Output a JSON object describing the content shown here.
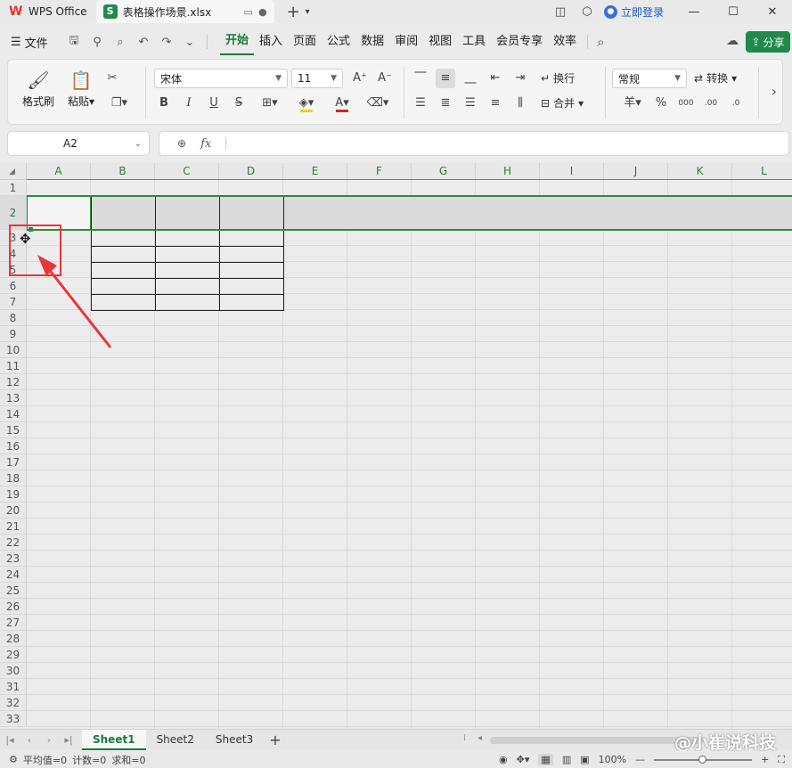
{
  "titlebar": {
    "app_tab": "WPS Office",
    "file_tab": "表格操作场景.xlsx",
    "file_badge": "S",
    "login": "立即登录"
  },
  "menubar": {
    "file": "文件",
    "items": [
      "开始",
      "插入",
      "页面",
      "公式",
      "数据",
      "审阅",
      "视图",
      "工具",
      "会员专享",
      "效率"
    ],
    "active": "开始",
    "share": "分享"
  },
  "ribbon": {
    "format_painter": "格式刷",
    "paste": "粘贴",
    "font_name": "宋体",
    "font_size": "11",
    "wrap": "换行",
    "merge": "合并",
    "number_format": "常规",
    "convert": "转换",
    "bold": "B",
    "italic": "I",
    "underline": "U",
    "strike": "S",
    "font_color_glyph": "A",
    "grow_glyph": "A",
    "shrink_glyph": "A",
    "currency": "羊",
    "percent": "%"
  },
  "formula_bar": {
    "name_box": "A2",
    "fx": "fx",
    "value": ""
  },
  "grid": {
    "columns": [
      "A",
      "B",
      "C",
      "D",
      "E",
      "F",
      "G",
      "H",
      "I",
      "J",
      "K",
      "L"
    ],
    "rows": [
      "1",
      "2",
      "3",
      "4",
      "5",
      "6",
      "7",
      "8",
      "9",
      "10",
      "11",
      "12",
      "13",
      "14",
      "15",
      "16",
      "17",
      "18",
      "19",
      "20",
      "21",
      "22",
      "23",
      "24",
      "25",
      "26",
      "27",
      "28",
      "29",
      "30",
      "31",
      "32",
      "33"
    ]
  },
  "sheets": {
    "tabs": [
      "Sheet1",
      "Sheet2",
      "Sheet3"
    ],
    "active": "Sheet1",
    "watermark": "@小崔说科技"
  },
  "status": {
    "average": "平均值=0",
    "count": "计数=0",
    "sum": "求和=0",
    "zoom": "100%"
  },
  "colors": {
    "accent": "#1a7a3e",
    "selection": "#2e8b3d",
    "annotation": "#e8363a"
  }
}
